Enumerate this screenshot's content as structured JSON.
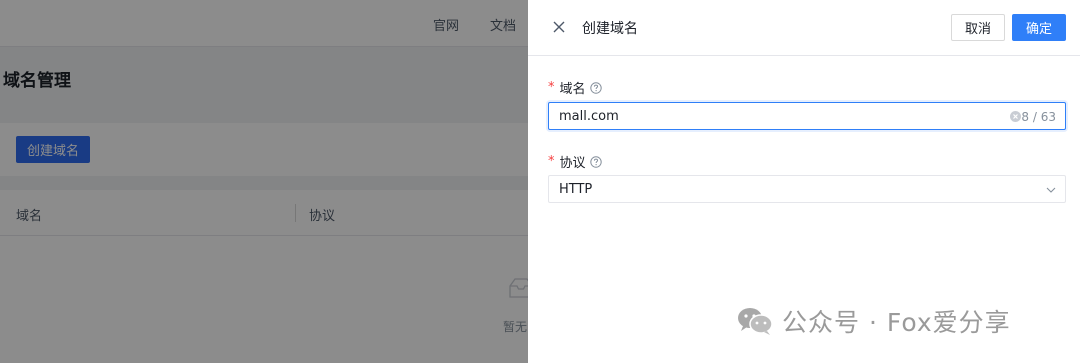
{
  "background": {
    "nav": {
      "links": [
        "官网",
        "文档"
      ]
    },
    "page_title": "域名管理",
    "create_button": "创建域名",
    "table": {
      "columns": [
        "域名",
        "协议"
      ],
      "empty_text": "暂无"
    }
  },
  "drawer": {
    "title": "创建域名",
    "cancel_label": "取消",
    "confirm_label": "确定",
    "fields": {
      "domain": {
        "label": "域名",
        "value": "mall.com",
        "counter": "8 / 63",
        "required": true
      },
      "protocol": {
        "label": "协议",
        "value": "HTTP",
        "required": true
      }
    }
  },
  "watermark": {
    "text": "公众号 · Fox爱分享"
  },
  "colors": {
    "primary": "#2f7ff8",
    "required": "#f53f3f",
    "mask": "rgba(0,0,0,0.45)"
  },
  "icons": [
    "close-icon",
    "help-icon",
    "clear-icon",
    "chevron-down-icon",
    "empty-box-icon",
    "wechat-icon"
  ]
}
